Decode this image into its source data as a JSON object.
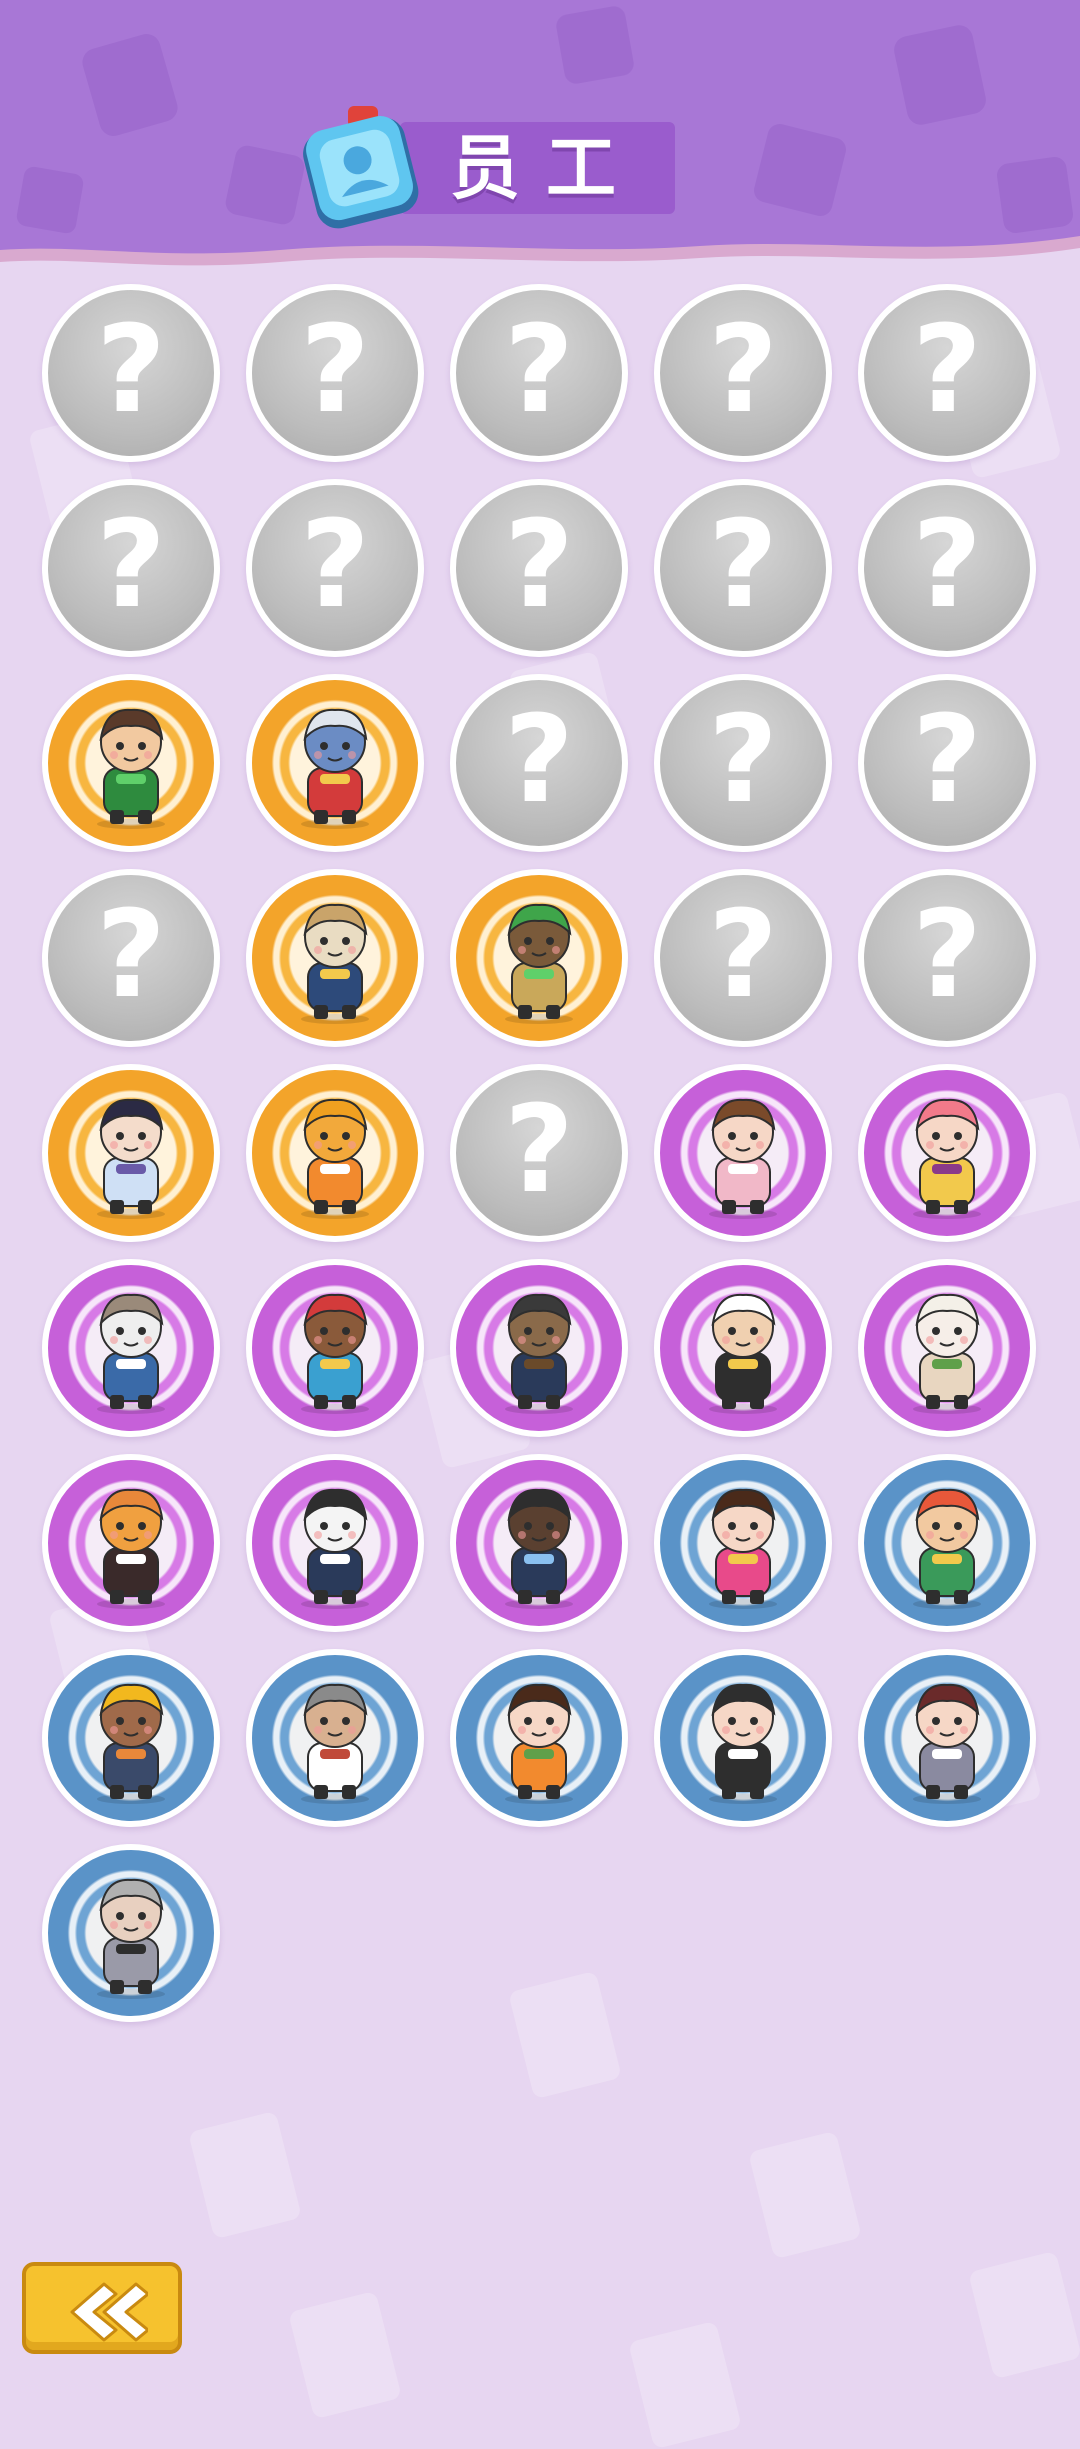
{
  "header": {
    "title": "员工",
    "icon": "staff-badge-icon"
  },
  "colors": {
    "header": "#a877d6",
    "background": "#e7d6f1",
    "gold": "#f3a42a",
    "purple": "#c660d9",
    "blue": "#5a93c8",
    "back_button": "#f6c22e"
  },
  "employees": [
    {
      "state": "locked",
      "label": "?"
    },
    {
      "state": "locked",
      "label": "?"
    },
    {
      "state": "locked",
      "label": "?"
    },
    {
      "state": "locked",
      "label": "?"
    },
    {
      "state": "locked",
      "label": "?"
    },
    {
      "state": "locked",
      "label": "?"
    },
    {
      "state": "locked",
      "label": "?"
    },
    {
      "state": "locked",
      "label": "?"
    },
    {
      "state": "locked",
      "label": "?"
    },
    {
      "state": "locked",
      "label": "?"
    },
    {
      "state": "unlocked",
      "rarity": "gold",
      "skin": "#f2c9a0",
      "hair": "#5a3a2a",
      "outfit": "#2e8b3e",
      "accent": "#5fd06a"
    },
    {
      "state": "unlocked",
      "rarity": "gold",
      "skin": "#6b8cc4",
      "hair": "#e0e6ee",
      "outfit": "#d33b3b",
      "accent": "#f2c94c"
    },
    {
      "state": "locked",
      "label": "?"
    },
    {
      "state": "locked",
      "label": "?"
    },
    {
      "state": "locked",
      "label": "?"
    },
    {
      "state": "locked",
      "label": "?"
    },
    {
      "state": "unlocked",
      "rarity": "gold",
      "skin": "#e9dcc2",
      "hair": "#c9a46a",
      "outfit": "#2d4a7a",
      "accent": "#f2c94c"
    },
    {
      "state": "unlocked",
      "rarity": "gold",
      "skin": "#7a5a3a",
      "hair": "#3fa54a",
      "outfit": "#c9a85a",
      "accent": "#5fd06a"
    },
    {
      "state": "locked",
      "label": "?"
    },
    {
      "state": "locked",
      "label": "?"
    },
    {
      "state": "unlocked",
      "rarity": "gold",
      "skin": "#f4dccb",
      "hair": "#2b2a44",
      "outfit": "#cfe0f5",
      "accent": "#6a5aa8"
    },
    {
      "state": "unlocked",
      "rarity": "gold",
      "skin": "#f2a93b",
      "hair": "#f0a020",
      "outfit": "#f28a2e",
      "accent": "#ffffff"
    },
    {
      "state": "locked",
      "label": "?"
    },
    {
      "state": "unlocked",
      "rarity": "purple",
      "skin": "#f6d7c6",
      "hair": "#7a4a2a",
      "outfit": "#f1b8c8",
      "accent": "#ffffff"
    },
    {
      "state": "unlocked",
      "rarity": "purple",
      "skin": "#f6d7c6",
      "hair": "#f27a8a",
      "outfit": "#f2c94c",
      "accent": "#8a3a8a"
    },
    {
      "state": "unlocked",
      "rarity": "purple",
      "skin": "#eeeeee",
      "hair": "#9a8a7a",
      "outfit": "#3a6aa8",
      "accent": "#ffffff"
    },
    {
      "state": "unlocked",
      "rarity": "purple",
      "skin": "#8a5a3a",
      "hair": "#d33b3b",
      "outfit": "#3aa0d0",
      "accent": "#f2c94c"
    },
    {
      "state": "unlocked",
      "rarity": "purple",
      "skin": "#8a6a4a",
      "hair": "#3a3a3a",
      "outfit": "#2a3a5a",
      "accent": "#6a4a2a"
    },
    {
      "state": "unlocked",
      "rarity": "purple",
      "skin": "#f0d0b0",
      "hair": "#ffffff",
      "outfit": "#2e2e2e",
      "accent": "#f2c94c"
    },
    {
      "state": "unlocked",
      "rarity": "purple",
      "skin": "#f6eee8",
      "hair": "#f4f0e8",
      "outfit": "#e8d6c0",
      "accent": "#5fa04a"
    },
    {
      "state": "unlocked",
      "rarity": "purple",
      "skin": "#f0a040",
      "hair": "#e8883a",
      "outfit": "#3a2a2a",
      "accent": "#ffffff"
    },
    {
      "state": "unlocked",
      "rarity": "purple",
      "skin": "#f4f4f4",
      "hair": "#2e2e2e",
      "outfit": "#2a3a5a",
      "accent": "#ffffff"
    },
    {
      "state": "unlocked",
      "rarity": "purple",
      "skin": "#5a4030",
      "hair": "#2e2e2e",
      "outfit": "#2a3a5a",
      "accent": "#8ac0f0"
    },
    {
      "state": "unlocked",
      "rarity": "blue",
      "skin": "#f6d7c6",
      "hair": "#4a2a1a",
      "outfit": "#e84a8a",
      "accent": "#f2c94c"
    },
    {
      "state": "unlocked",
      "rarity": "blue",
      "skin": "#f2c9a0",
      "hair": "#e8583a",
      "outfit": "#3a9a5a",
      "accent": "#f2c94c"
    },
    {
      "state": "unlocked",
      "rarity": "blue",
      "skin": "#a06a4a",
      "hair": "#f2b81e",
      "outfit": "#3a4a6a",
      "accent": "#e8883a"
    },
    {
      "state": "unlocked",
      "rarity": "blue",
      "skin": "#d8b090",
      "hair": "#8a8a8a",
      "outfit": "#ffffff",
      "accent": "#c04a3a"
    },
    {
      "state": "unlocked",
      "rarity": "blue",
      "skin": "#f6d7c6",
      "hair": "#4a2a1a",
      "outfit": "#f28a2e",
      "accent": "#5fa04a"
    },
    {
      "state": "unlocked",
      "rarity": "blue",
      "skin": "#f6d7c6",
      "hair": "#2e2e2e",
      "outfit": "#2e2e2e",
      "accent": "#ffffff"
    },
    {
      "state": "unlocked",
      "rarity": "blue",
      "skin": "#f6d7c6",
      "hair": "#6a2a2a",
      "outfit": "#8a8aa0",
      "accent": "#ffffff"
    },
    {
      "state": "unlocked",
      "rarity": "blue",
      "skin": "#e8d0c0",
      "hair": "#b0b0b0",
      "outfit": "#9a9aa8",
      "accent": "#2e2e2e"
    }
  ],
  "back_button": {
    "icon": "chevron-left-icon"
  }
}
